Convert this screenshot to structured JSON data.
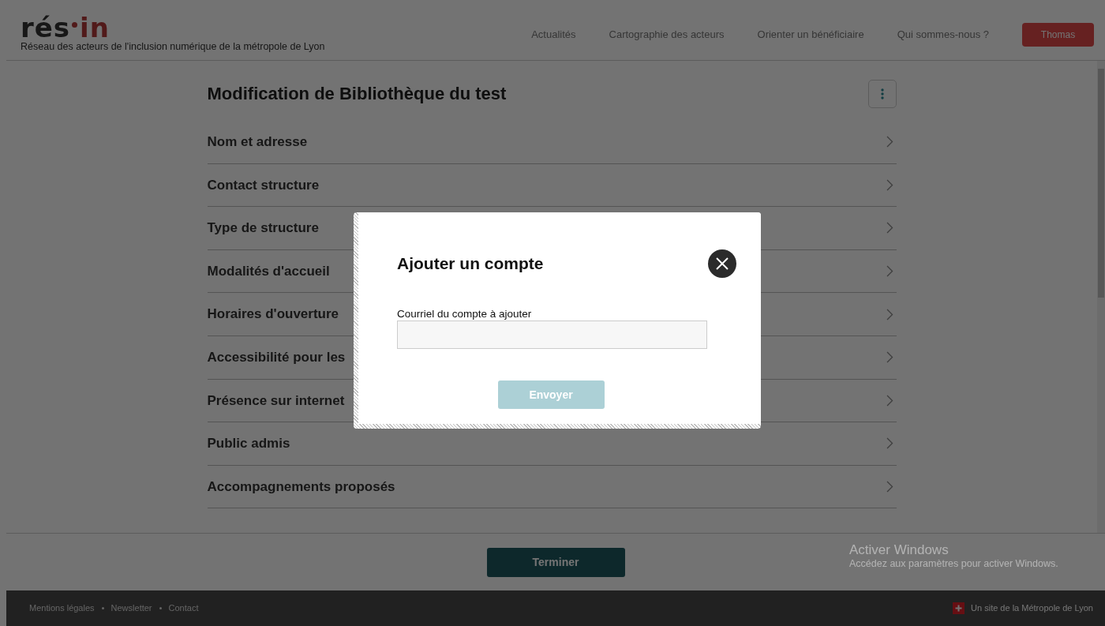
{
  "header": {
    "logo": {
      "dark_part": "rés",
      "accent_part": "in"
    },
    "tagline": "Réseau des acteurs de l'inclusion numérique de la métropole de Lyon",
    "nav": [
      {
        "label": "Actualités"
      },
      {
        "label": "Cartographie des acteurs"
      },
      {
        "label": "Orienter un bénéficiaire"
      },
      {
        "label": "Qui sommes-nous ?"
      }
    ],
    "user_button": "Thomas"
  },
  "page": {
    "title": "Modification de Bibliothèque du test",
    "sections": [
      {
        "label": "Nom et adresse"
      },
      {
        "label": "Contact structure"
      },
      {
        "label": "Type de structure"
      },
      {
        "label": "Modalités d'accueil"
      },
      {
        "label": "Horaires d'ouverture"
      },
      {
        "label": "Accessibilité pour les"
      },
      {
        "label": "Présence sur internet"
      },
      {
        "label": "Public admis"
      },
      {
        "label": "Accompagnements proposés"
      }
    ],
    "finish_button": "Terminer"
  },
  "footer": {
    "links": [
      "Mentions légales",
      "Newsletter",
      "Contact"
    ],
    "credit": "Un site de la Métropole de Lyon"
  },
  "modal": {
    "open": true,
    "title": "Ajouter un compte",
    "field": {
      "label": "Courriel du compte à ajouter"
    },
    "submit": {
      "label": "Envoyer",
      "disabled": true
    }
  },
  "os_notice": {
    "title": "Activer Windows",
    "text": "Accédez aux paramètres pour activer Windows."
  }
}
